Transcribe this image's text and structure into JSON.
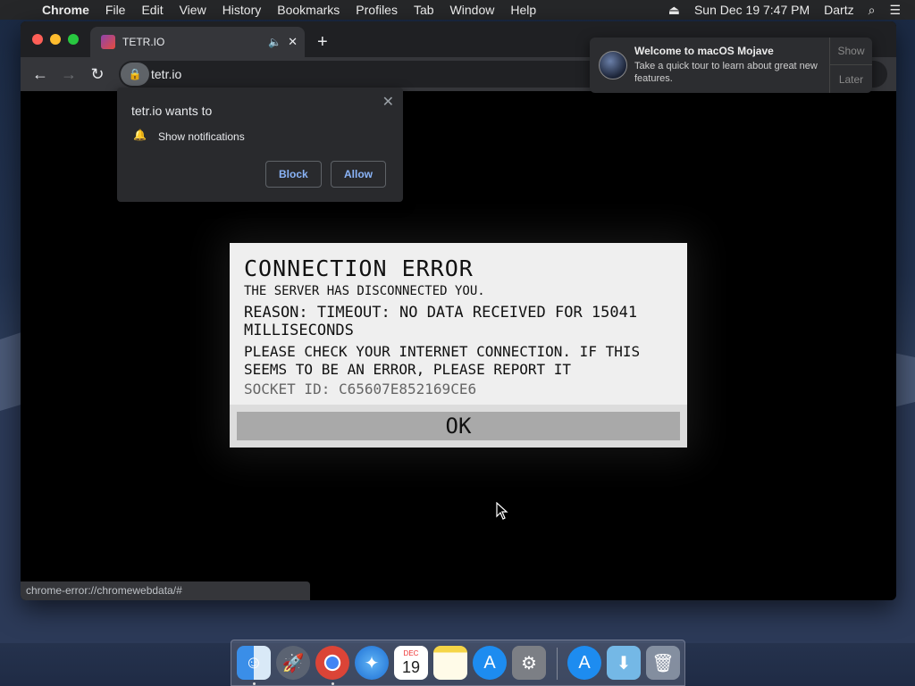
{
  "menubar": {
    "app": "Chrome",
    "items": [
      "File",
      "Edit",
      "View",
      "History",
      "Bookmarks",
      "Profiles",
      "Tab",
      "Window",
      "Help"
    ],
    "clock": "Sun Dec 19  7:47 PM",
    "user": "Dartz"
  },
  "browser": {
    "tab_title": "TETR.IO",
    "url": "tetr.io",
    "status_url": "chrome-error://chromewebdata/#"
  },
  "permission_popup": {
    "title": "tetr.io wants to",
    "request": "Show notifications",
    "block": "Block",
    "allow": "Allow"
  },
  "notification": {
    "title": "Welcome to macOS Mojave",
    "body": "Take a quick tour to learn about great new features.",
    "show": "Show",
    "later": "Later"
  },
  "error_dialog": {
    "heading": "CONNECTION ERROR",
    "line1": "THE SERVER HAS DISCONNECTED YOU.",
    "line2": "REASON: TIMEOUT: NO DATA RECEIVED FOR 15041 MILLISECONDS",
    "line3": "PLEASE CHECK YOUR INTERNET CONNECTION. IF THIS SEEMS TO BE AN ERROR, PLEASE REPORT IT",
    "socket": "SOCKET ID: C65607E852169CE6",
    "ok": "OK"
  },
  "dock": {
    "calendar_month": "DEC",
    "calendar_day": "19"
  }
}
